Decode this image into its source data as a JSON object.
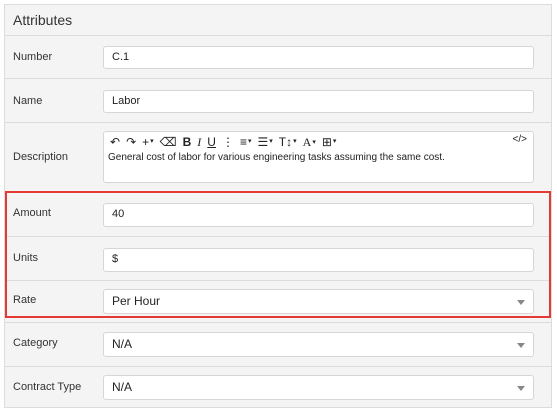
{
  "panel": {
    "title": "Attributes"
  },
  "fields": {
    "number": {
      "label": "Number",
      "value": "C.1"
    },
    "name": {
      "label": "Name",
      "value": "Labor"
    },
    "description": {
      "label": "Description",
      "text": "General cost of labor for various engineering tasks assuming the same cost."
    },
    "amount": {
      "label": "Amount",
      "value": "40"
    },
    "units": {
      "label": "Units",
      "value": "$"
    },
    "rate": {
      "label": "Rate",
      "value": "Per Hour"
    },
    "category": {
      "label": "Category",
      "value": "N/A"
    },
    "contract_type": {
      "label": "Contract Type",
      "value": "N/A"
    }
  },
  "toolbar": {
    "undo": "↶",
    "redo": "↷",
    "insert": "+",
    "clear_format": "⌫",
    "bold": "B",
    "italic": "I",
    "underline": "U",
    "more": "⋮",
    "align": "≡",
    "list": "☰",
    "text_size": "T↕",
    "font_color": "A",
    "table": "⊞",
    "code": "</>"
  },
  "highlight_color": "#e53935"
}
